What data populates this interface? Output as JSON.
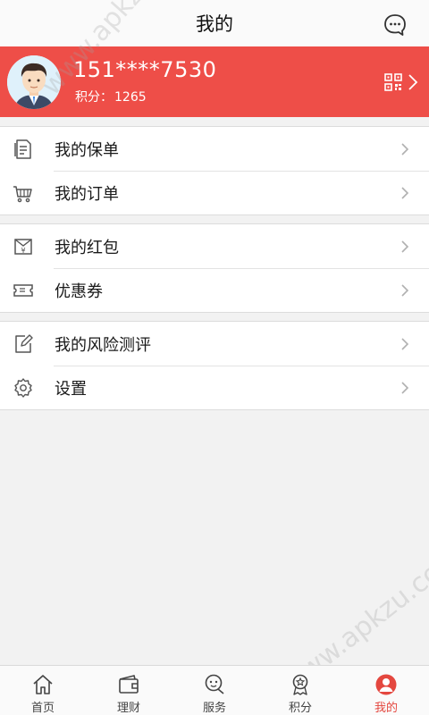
{
  "header": {
    "title": "我的",
    "message_icon": "chat-bubble-icon"
  },
  "profile": {
    "phone": "151****7530",
    "points_label": "积分：",
    "points_value": "1265",
    "qr_icon": "qr-code-icon",
    "avatar": "user-avatar"
  },
  "menu": {
    "group1": [
      {
        "label": "我的保单",
        "icon": "policy-document-icon"
      },
      {
        "label": "我的订单",
        "icon": "shopping-cart-icon"
      }
    ],
    "group2": [
      {
        "label": "我的红包",
        "icon": "red-envelope-icon"
      },
      {
        "label": "优惠券",
        "icon": "coupon-icon"
      }
    ],
    "group3": [
      {
        "label": "我的风险测评",
        "icon": "edit-icon"
      },
      {
        "label": "设置",
        "icon": "gear-icon"
      }
    ]
  },
  "tabs": [
    {
      "label": "首页",
      "icon": "home-icon"
    },
    {
      "label": "理财",
      "icon": "wallet-icon"
    },
    {
      "label": "服务",
      "icon": "service-icon"
    },
    {
      "label": "积分",
      "icon": "medal-icon"
    },
    {
      "label": "我的",
      "icon": "profile-icon",
      "active": true
    }
  ],
  "watermark": "www.apkzu.com",
  "colors": {
    "accent": "#ee4e48",
    "active_tab": "#e4473f"
  }
}
